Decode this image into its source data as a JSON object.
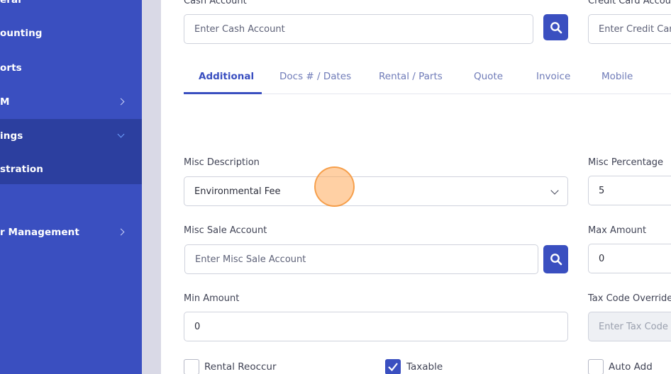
{
  "sidebar": {
    "items": [
      {
        "label": "eral",
        "chevron": ""
      },
      {
        "label": "ounting",
        "chevron": ""
      },
      {
        "label": "orts",
        "chevron": ""
      },
      {
        "label": "M",
        "chevron": "right"
      },
      {
        "label": "ings",
        "chevron": "down"
      },
      {
        "label": "stration",
        "chevron": ""
      },
      {
        "label": "r Management",
        "chevron": "right"
      }
    ]
  },
  "form": {
    "cash_account": {
      "label": "Cash Account",
      "placeholder": "Enter Cash Account"
    },
    "credit_card_account": {
      "label": "Credit Card Accou",
      "placeholder": "Enter Credit Car"
    },
    "misc_description": {
      "label": "Misc Description",
      "value": "Environmental Fee"
    },
    "misc_percentage": {
      "label": "Misc Percentage",
      "value": "5"
    },
    "misc_sale_account": {
      "label": "Misc Sale Account",
      "placeholder": "Enter Misc Sale Account"
    },
    "max_amount": {
      "label": "Max Amount",
      "value": "0"
    },
    "min_amount": {
      "label": "Min Amount",
      "value": "0"
    },
    "tax_code_override": {
      "label": "Tax Code Override",
      "placeholder": "Enter Tax Code"
    },
    "checkboxes": {
      "rental_reoccur": {
        "label": "Rental Reoccur",
        "checked": false
      },
      "taxable": {
        "label": "Taxable",
        "checked": true
      },
      "auto_add": {
        "label": "Auto Add",
        "checked": false
      }
    }
  },
  "tabs": [
    {
      "label": "Additional",
      "active": true
    },
    {
      "label": "Docs # / Dates",
      "active": false
    },
    {
      "label": "Rental / Parts",
      "active": false
    },
    {
      "label": "Quote",
      "active": false
    },
    {
      "label": "Invoice",
      "active": false
    },
    {
      "label": "Mobile",
      "active": false
    }
  ],
  "colors": {
    "primary": "#3a4fc0",
    "sidebar_active": "#2c3f9f"
  }
}
